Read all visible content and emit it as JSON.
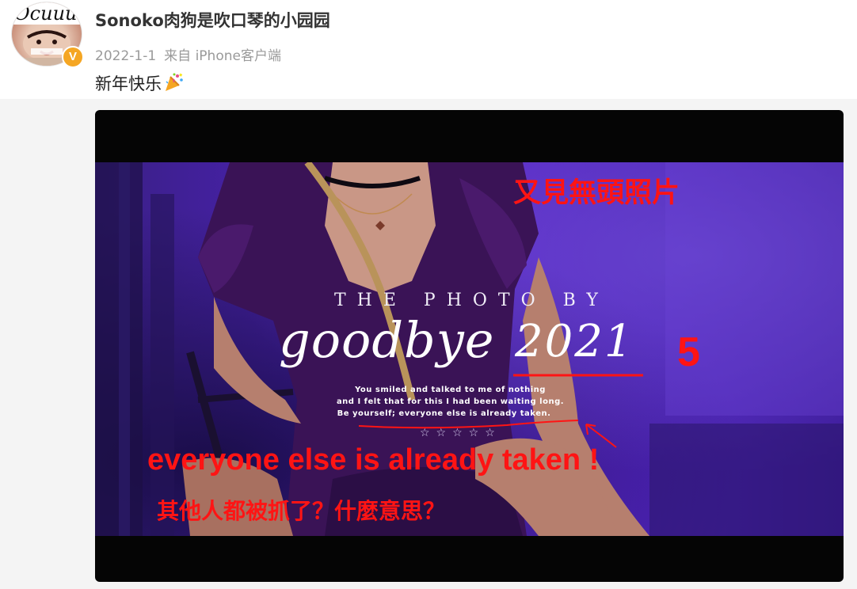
{
  "post": {
    "username": "Sonoko肉狗是吹口琴的小园园",
    "date": "2022-1-1",
    "source": "来自 iPhone客户端",
    "text": "新年快乐",
    "verified_badge": "V",
    "avatar_text": "Ocuuu"
  },
  "photo": {
    "caption_top": "THE PHOTO BY",
    "caption_word": "goodbye",
    "caption_year": "2021",
    "quote_lines": [
      "You smiled and talked to me of nothing",
      "and I felt that for this I had been waiting long.",
      "Be yourself; everyone else is already taken."
    ],
    "stars": "☆☆☆☆☆"
  },
  "annotations": {
    "headless_note": "又見無頭照片",
    "number_note": "5",
    "taken_note": "everyone else is already taken !",
    "question_note": "其他人都被抓了？什麼意思？",
    "color": "#ff1414"
  },
  "icons": {
    "confetti": "confetti-icon",
    "verified": "verified-icon"
  }
}
